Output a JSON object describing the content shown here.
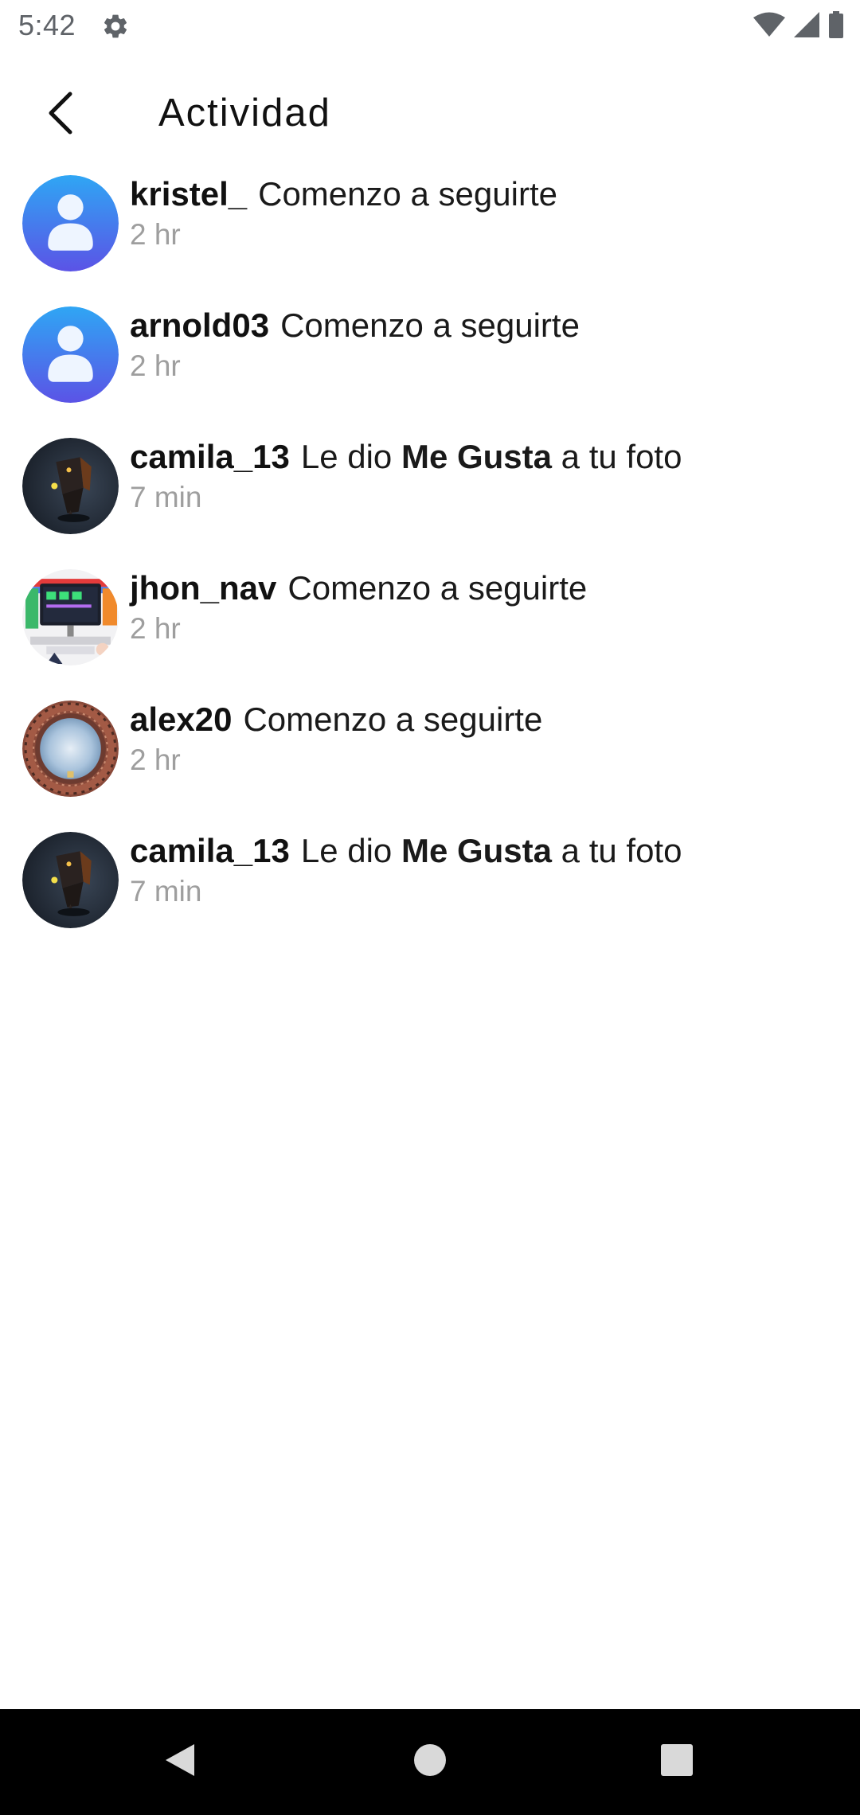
{
  "status_bar": {
    "time": "5:42",
    "icons": [
      "gear-icon",
      "wifi-icon",
      "cell-signal-icon",
      "battery-icon"
    ]
  },
  "header": {
    "title": "Actividad",
    "back_icon": "chevron-left-icon"
  },
  "activities": [
    {
      "username": "kristel_",
      "action_pre": "Comenzo a seguirte",
      "action_bold": "",
      "action_post": "",
      "time": "2 hr",
      "avatar": "default-user-avatar"
    },
    {
      "username": "arnold03",
      "action_pre": "Comenzo a seguirte",
      "action_bold": "",
      "action_post": "",
      "time": "2 hr",
      "avatar": "default-user-avatar"
    },
    {
      "username": "camila_13",
      "action_pre": "Le dio",
      "action_bold": "Me Gusta",
      "action_post": "a tu foto",
      "time": "7 min",
      "avatar": "dark-scene-avatar"
    },
    {
      "username": "jhon_nav",
      "action_pre": "Comenzo a seguirte",
      "action_bold": "",
      "action_post": "",
      "time": "2 hr",
      "avatar": "desk-setup-avatar"
    },
    {
      "username": "alex20",
      "action_pre": "Comenzo a seguirte",
      "action_bold": "",
      "action_post": "",
      "time": "2 hr",
      "avatar": "sky-building-avatar"
    },
    {
      "username": "camila_13",
      "action_pre": "Le dio",
      "action_bold": "Me Gusta",
      "action_post": "a tu foto",
      "time": "7 min",
      "avatar": "dark-scene-avatar"
    }
  ],
  "colors": {
    "default_avatar_top": "#2fa6f4",
    "default_avatar_bottom": "#5b53e6",
    "time_text": "#9e9e9e",
    "nav_bar": "#000000"
  },
  "nav_bar": {
    "icons": [
      "back-triangle-icon",
      "home-circle-icon",
      "recents-square-icon"
    ]
  }
}
